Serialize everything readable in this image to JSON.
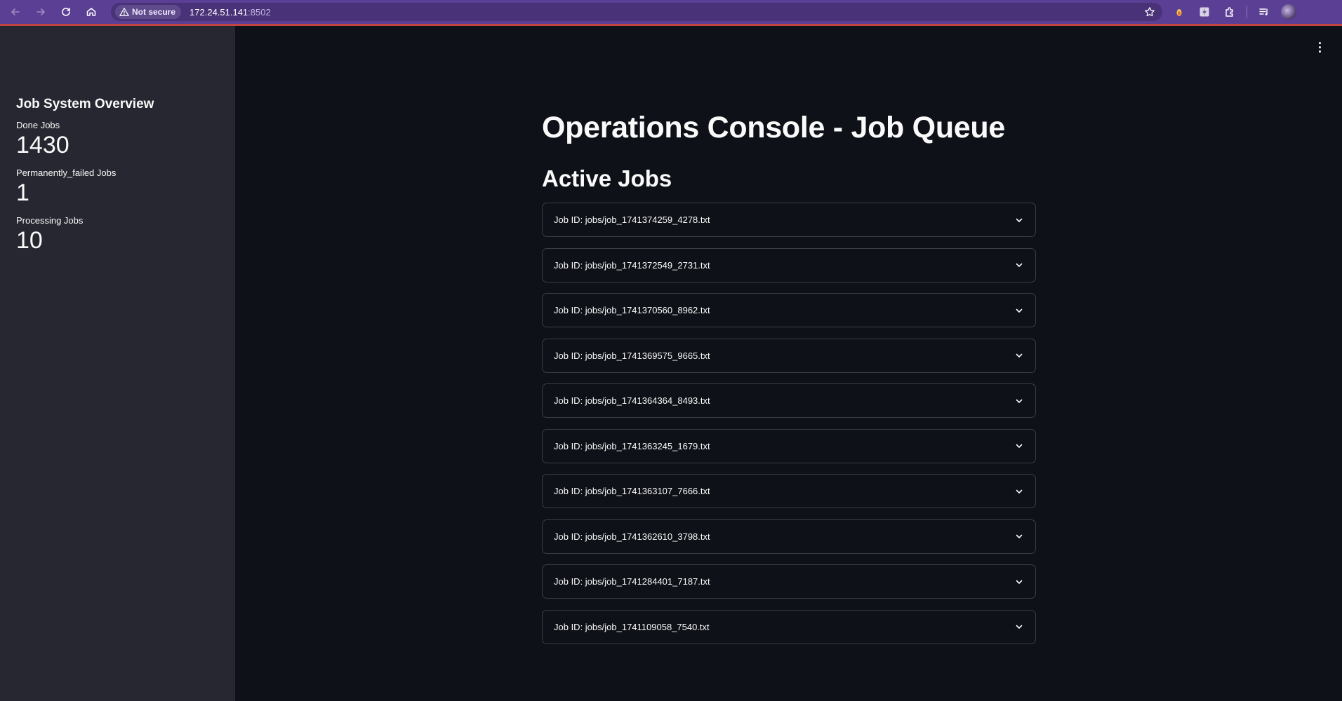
{
  "browser": {
    "security_label": "Not secure",
    "url_host": "172.24.51.141",
    "url_port": ":8502"
  },
  "sidebar": {
    "title": "Job System Overview",
    "metrics": [
      {
        "label": "Done Jobs",
        "value": "1430"
      },
      {
        "label": "Permanently_failed Jobs",
        "value": "1"
      },
      {
        "label": "Processing Jobs",
        "value": "10"
      }
    ]
  },
  "main": {
    "title": "Operations Console - Job Queue",
    "section": "Active Jobs",
    "jobs": [
      "Job ID: jobs/job_1741374259_4278.txt",
      "Job ID: jobs/job_1741372549_2731.txt",
      "Job ID: jobs/job_1741370560_8962.txt",
      "Job ID: jobs/job_1741369575_9665.txt",
      "Job ID: jobs/job_1741364364_8493.txt",
      "Job ID: jobs/job_1741363245_1679.txt",
      "Job ID: jobs/job_1741363107_7666.txt",
      "Job ID: jobs/job_1741362610_3798.txt",
      "Job ID: jobs/job_1741284401_7187.txt",
      "Job ID: jobs/job_1741109058_7540.txt"
    ]
  }
}
